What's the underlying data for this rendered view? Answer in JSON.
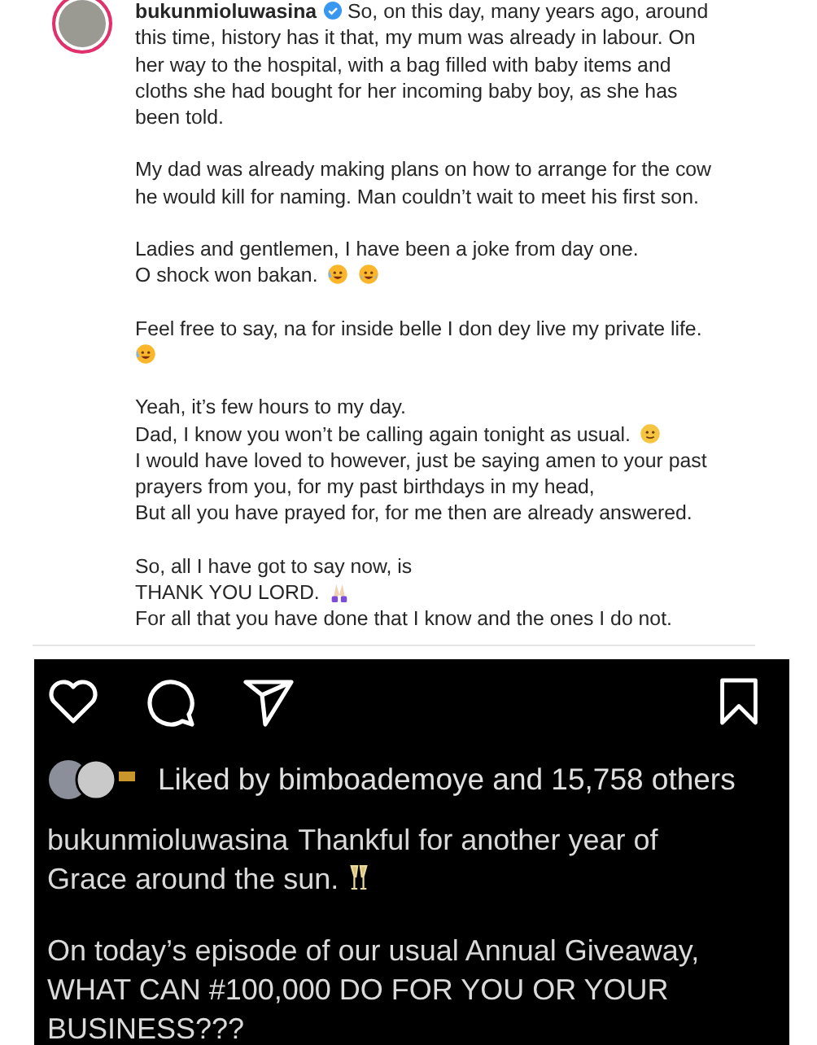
{
  "post": {
    "username": "bukunmioluwasina",
    "verified": true,
    "paragraphs": [
      {
        "lines": [
          {
            "text": "So, on this day, many years ago, around"
          },
          {
            "text": "this time, history has it that, my mum was already in labour. On"
          },
          {
            "text": "her way to the hospital, with a bag filled with baby items and"
          },
          {
            "text": "cloths she had bought for her incoming baby boy, as she has"
          },
          {
            "text": "been told."
          }
        ]
      },
      {
        "lines": [
          {
            "text": "My dad was already making plans on how to arrange for the cow"
          },
          {
            "text": "he would kill for naming. Man couldn’t wait to meet his first son."
          }
        ]
      },
      {
        "lines": [
          {
            "text": "Ladies and gentlemen, I have been a joke from day one."
          },
          {
            "text": "O shock won bakan.",
            "emoji": [
              {
                "kind": "rofl"
              },
              {
                "kind": "laugh"
              }
            ]
          }
        ]
      },
      {
        "lines": [
          {
            "text": "Feel free to say, na for inside belle I don dey live my private life."
          },
          {
            "emoji": [
              {
                "kind": "rofl"
              }
            ]
          }
        ]
      },
      {
        "lines": [
          {
            "text": "Yeah, it’s few hours to my day."
          },
          {
            "text": "Dad, I know you won’t be calling again tonight as usual.",
            "emoji": [
              {
                "kind": "smile"
              }
            ]
          },
          {
            "text": "I would have loved to however, just be saying amen to your past"
          },
          {
            "text": "prayers from you, for my past birthdays in my head,"
          },
          {
            "text": "But all you have prayed for, for me then are already answered."
          }
        ]
      },
      {
        "lines": [
          {
            "text": "So, all I have got to say now, is"
          },
          {
            "text": "THANK YOU LORD.",
            "emoji": [
              {
                "kind": "pray"
              }
            ]
          },
          {
            "text": "For all that you have done that I know and the ones I do not."
          }
        ]
      }
    ]
  },
  "screenshot": {
    "liked_by": "Liked by bimboademoye and 15,758 others",
    "caption_user": "bukunmioluwasina",
    "caption_lines": [
      {
        "text": "Thankful for another year of"
      },
      {
        "text": "Grace around the sun.",
        "emoji": [
          {
            "kind": "cheers"
          }
        ]
      }
    ],
    "giveaway_lines": [
      "On today’s episode of our usual Annual Giveaway,",
      "WHAT CAN #100,000 DO FOR YOU OR YOUR",
      "BUSINESS???"
    ]
  }
}
